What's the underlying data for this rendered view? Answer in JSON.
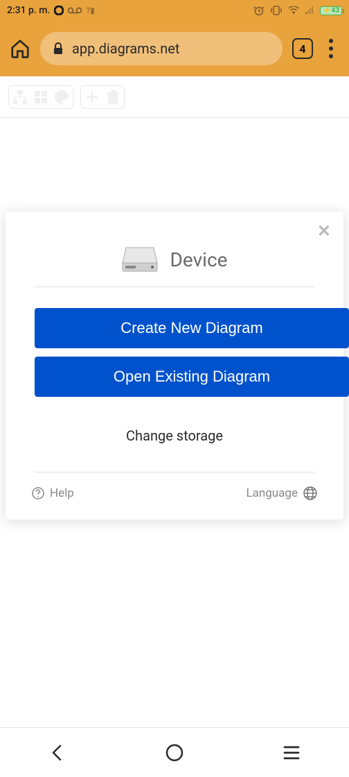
{
  "status_bar": {
    "time": "2:31 p. m.",
    "battery_level": "43"
  },
  "browser": {
    "url": "app.diagrams.net",
    "tab_count": "4"
  },
  "modal": {
    "title": "Device",
    "create_button": "Create New Diagram",
    "open_button": "Open Existing Diagram",
    "change_storage": "Change storage",
    "help": "Help",
    "language": "Language"
  }
}
